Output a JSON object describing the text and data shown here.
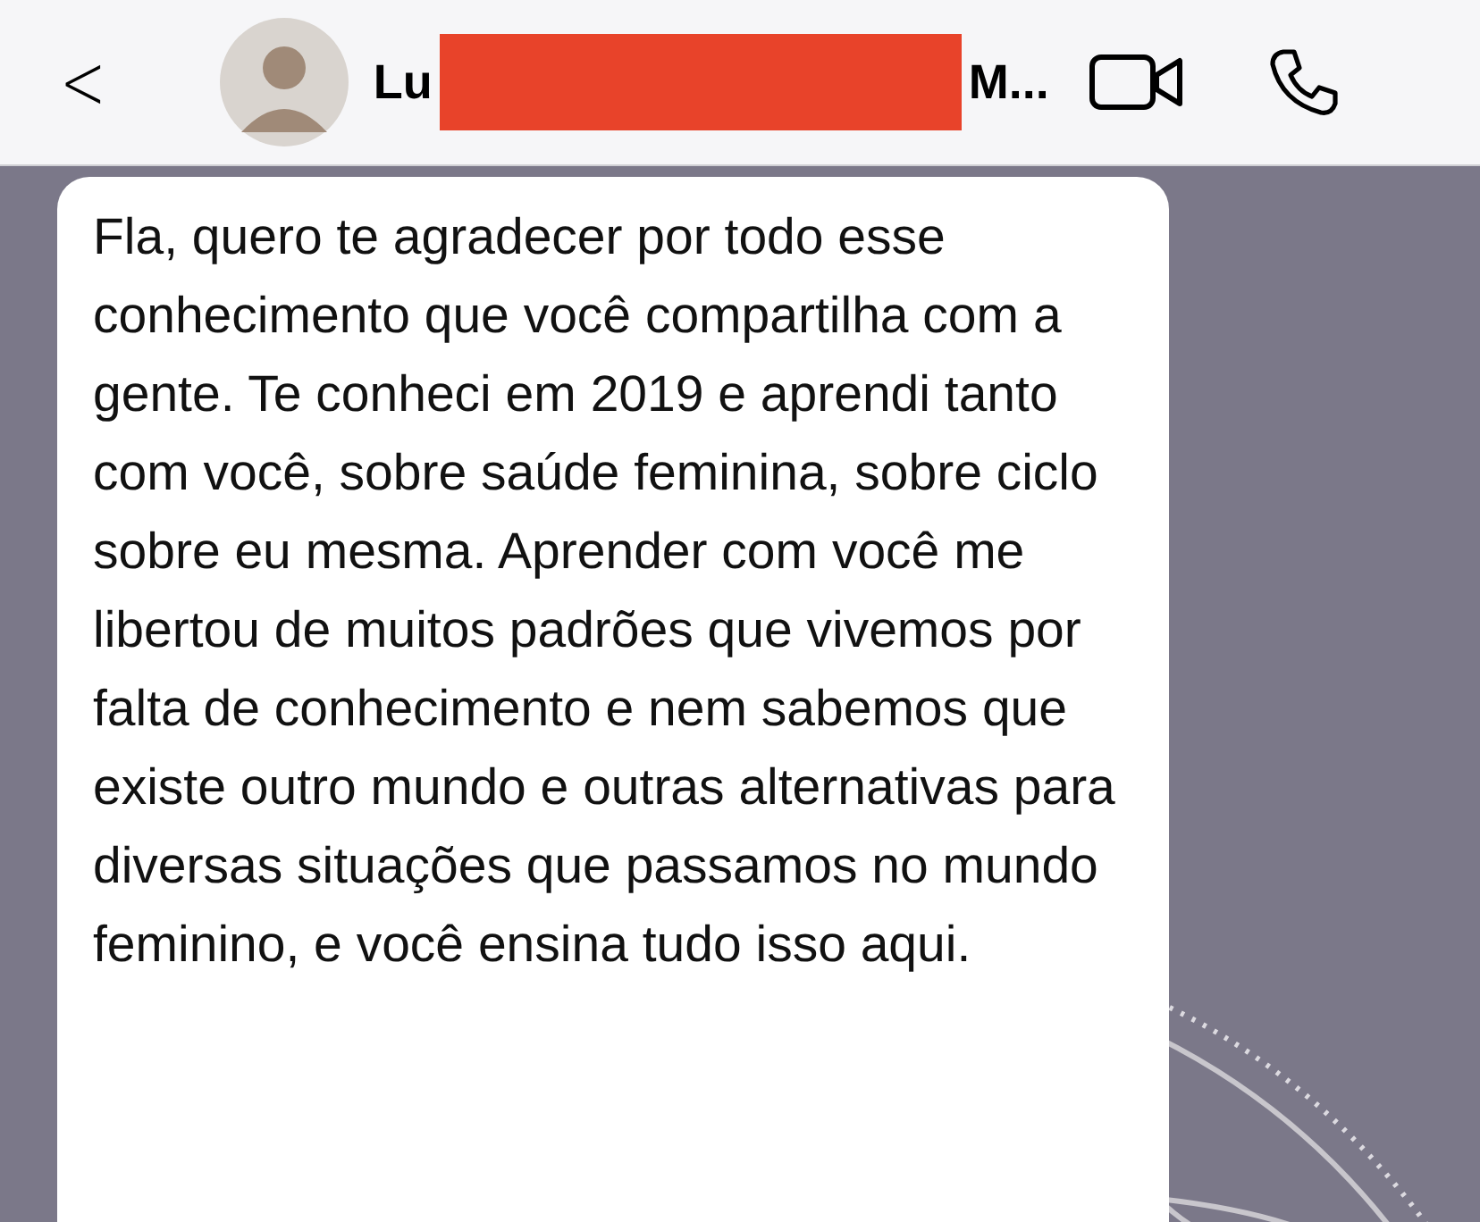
{
  "header": {
    "back": "<",
    "name_start": "Lu",
    "redacted": true,
    "name_end": "M..."
  },
  "message": {
    "text": "Fla, quero te agradecer por todo esse conhecimento que você compartilha com a gente. Te conheci em 2019 e aprendi tanto com você, sobre saúde feminina, sobre ciclo sobre eu mesma. Aprender com você me libertou de muitos padrões que vivemos por falta de conhecimento e nem sabemos que existe outro mundo e outras alternativas para diversas situações que passamos no mundo feminino, e você ensina tudo isso aqui."
  }
}
